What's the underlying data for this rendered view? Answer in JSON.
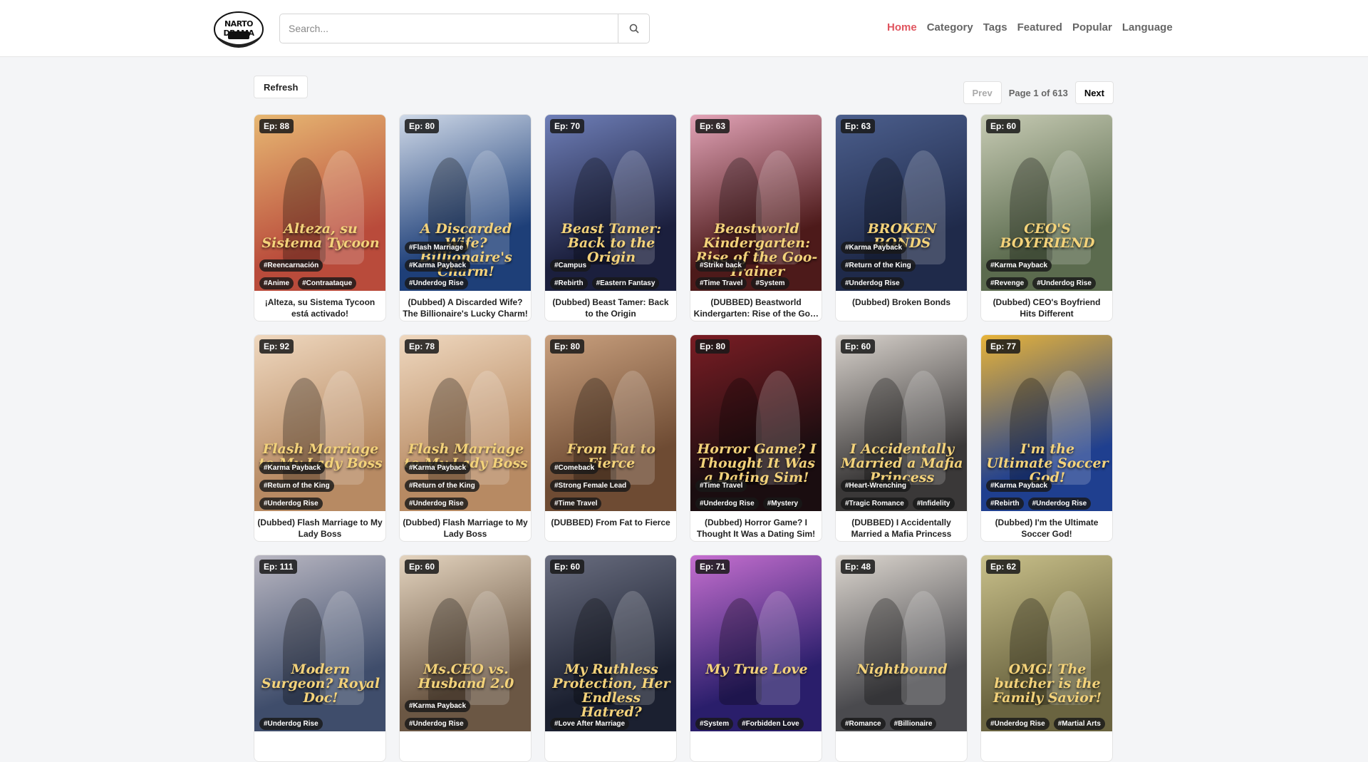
{
  "header": {
    "logo_text": "NARTO DRAMA",
    "search_placeholder": "Search...",
    "nav": [
      "Home",
      "Category",
      "Tags",
      "Featured",
      "Popular",
      "Language"
    ]
  },
  "controls": {
    "refresh": "Refresh",
    "prev": "Prev",
    "page_info": "Page 1 of 613",
    "next": "Next"
  },
  "cards": [
    {
      "ep": "Ep: 88",
      "poster_text": "Alteza, su Sistema Tycoon",
      "tags": [
        "#Anime",
        "#Contraataque",
        "#Reencarnación"
      ],
      "title": "¡Alteza, su Sistema Tycoon está activado!",
      "colors": [
        "#b94b3b",
        "#e7b873"
      ]
    },
    {
      "ep": "Ep: 80",
      "poster_text": "A Discarded Wife? Billionaire's Charm!",
      "tags": [
        "#Underdog Rise",
        "#Karma Payback",
        "#Flash Marriage"
      ],
      "title": "(Dubbed) A Discarded Wife? The Billionaire's Lucky Charm!",
      "colors": [
        "#1e3f78",
        "#cfd9e8"
      ]
    },
    {
      "ep": "Ep: 70",
      "poster_text": "Beast Tamer: Back to the Origin",
      "tags": [
        "#Rebirth",
        "#Eastern Fantasy",
        "#Campus"
      ],
      "title": "(Dubbed) Beast Tamer: Back to the Origin",
      "colors": [
        "#1b1f3d",
        "#6f7fb8"
      ]
    },
    {
      "ep": "Ep: 63",
      "poster_text": "Beastworld Kindergarten: Rise of the Goo-Trainer",
      "tags": [
        "#Time Travel",
        "#System",
        "#Strike back"
      ],
      "title": "(DUBBED) Beastworld Kindergarten: Rise of the Goo-Trainer",
      "colors": [
        "#4d1a1a",
        "#e3a4b8"
      ]
    },
    {
      "ep": "Ep: 63",
      "poster_text": "BROKEN BONDS",
      "tags": [
        "#Underdog Rise",
        "#Return of the King",
        "#Karma Payback"
      ],
      "title": "(Dubbed) Broken Bonds",
      "colors": [
        "#1f2a4a",
        "#4c5f8d"
      ]
    },
    {
      "ep": "Ep: 60",
      "poster_text": "CEO'S BOYFRIEND",
      "tags": [
        "#Revenge",
        "#Underdog Rise",
        "#Karma Payback"
      ],
      "title": "(Dubbed) CEO's Boyfriend Hits Different",
      "colors": [
        "#5b6b4e",
        "#c7cbb4"
      ]
    },
    {
      "ep": "Ep: 92",
      "poster_text": "Flash Marriage to My Lady Boss",
      "tags": [
        "#Underdog Rise",
        "#Return of the King",
        "#Karma Payback"
      ],
      "title": "(Dubbed) Flash Marriage to My Lady Boss",
      "colors": [
        "#b78a63",
        "#efd8bf"
      ]
    },
    {
      "ep": "Ep: 78",
      "poster_text": "Flash Marriage to My Lady Boss",
      "tags": [
        "#Underdog Rise",
        "#Return of the King",
        "#Karma Payback"
      ],
      "title": "(Dubbed) Flash Marriage to My Lady Boss",
      "colors": [
        "#b78a63",
        "#efd8bf"
      ]
    },
    {
      "ep": "Ep: 80",
      "poster_text": "From Fat to Fierce",
      "tags": [
        "#Time Travel",
        "#Strong Female Lead",
        "#Comeback"
      ],
      "title": "(DUBBED) From Fat to Fierce",
      "colors": [
        "#6e4b33",
        "#c9a07e"
      ]
    },
    {
      "ep": "Ep: 80",
      "poster_text": "Horror Game? I Thought It Was a Dating Sim!",
      "tags": [
        "#Underdog Rise",
        "#Mystery",
        "#Time Travel"
      ],
      "title": "(Dubbed) Horror Game? I Thought It Was a Dating Sim!",
      "colors": [
        "#1a0d10",
        "#7a1d24"
      ]
    },
    {
      "ep": "Ep: 60",
      "poster_text": "I Accidentally Married a Mafia Princess",
      "tags": [
        "#Tragic Romance",
        "#Infidelity",
        "#Heart-Wrenching"
      ],
      "title": "(DUBBED) I Accidentally Married a Mafia Princess",
      "colors": [
        "#3a3838",
        "#d8d2cc"
      ]
    },
    {
      "ep": "Ep: 77",
      "poster_text": "I'm the Ultimate Soccer God!",
      "tags": [
        "#Rebirth",
        "#Underdog Rise",
        "#Karma Payback"
      ],
      "title": "(Dubbed) I'm the Ultimate Soccer God!",
      "colors": [
        "#1f3f8f",
        "#e8b43a"
      ]
    },
    {
      "ep": "Ep: 111",
      "poster_text": "Modern Surgeon? Royal Doc!",
      "tags": [
        "#Underdog Rise"
      ],
      "title": "",
      "colors": [
        "#3f4d6b",
        "#b9b7c2"
      ]
    },
    {
      "ep": "Ep: 60",
      "poster_text": "Ms.CEO vs. Husband 2.0",
      "tags": [
        "#Underdog Rise",
        "#Karma Payback"
      ],
      "title": "",
      "colors": [
        "#6b5744",
        "#e4d4bf"
      ]
    },
    {
      "ep": "Ep: 60",
      "poster_text": "My Ruthless Protection, Her Endless Hatred?",
      "tags": [
        "#Love After Marriage"
      ],
      "title": "",
      "colors": [
        "#1b2030",
        "#6a6e80"
      ]
    },
    {
      "ep": "Ep: 71",
      "poster_text": "My True Love",
      "tags": [
        "#System",
        "#Forbidden Love"
      ],
      "title": "",
      "colors": [
        "#2a1e6b",
        "#c66fd0"
      ]
    },
    {
      "ep": "Ep: 48",
      "poster_text": "Nightbound",
      "tags": [
        "#Romance",
        "#Billionaire"
      ],
      "title": "",
      "colors": [
        "#4a4a4e",
        "#dcd6cf"
      ]
    },
    {
      "ep": "Ep: 62",
      "poster_text": "OMG! The butcher is the Family Savior!",
      "tags": [
        "#Underdog Rise",
        "#Martial Arts"
      ],
      "title": "",
      "colors": [
        "#6a6440",
        "#c9c08a"
      ]
    }
  ]
}
